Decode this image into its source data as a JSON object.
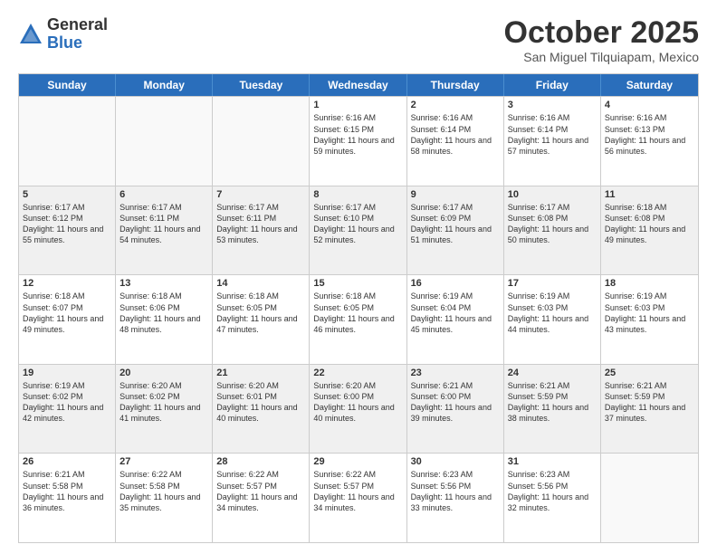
{
  "logo": {
    "general": "General",
    "blue": "Blue"
  },
  "title": "October 2025",
  "subtitle": "San Miguel Tilquiapam, Mexico",
  "days": [
    "Sunday",
    "Monday",
    "Tuesday",
    "Wednesday",
    "Thursday",
    "Friday",
    "Saturday"
  ],
  "rows": [
    [
      {
        "num": "",
        "info": "",
        "empty": true
      },
      {
        "num": "",
        "info": "",
        "empty": true
      },
      {
        "num": "",
        "info": "",
        "empty": true
      },
      {
        "num": "1",
        "info": "Sunrise: 6:16 AM\nSunset: 6:15 PM\nDaylight: 11 hours and 59 minutes."
      },
      {
        "num": "2",
        "info": "Sunrise: 6:16 AM\nSunset: 6:14 PM\nDaylight: 11 hours and 58 minutes."
      },
      {
        "num": "3",
        "info": "Sunrise: 6:16 AM\nSunset: 6:14 PM\nDaylight: 11 hours and 57 minutes."
      },
      {
        "num": "4",
        "info": "Sunrise: 6:16 AM\nSunset: 6:13 PM\nDaylight: 11 hours and 56 minutes."
      }
    ],
    [
      {
        "num": "5",
        "info": "Sunrise: 6:17 AM\nSunset: 6:12 PM\nDaylight: 11 hours and 55 minutes."
      },
      {
        "num": "6",
        "info": "Sunrise: 6:17 AM\nSunset: 6:11 PM\nDaylight: 11 hours and 54 minutes."
      },
      {
        "num": "7",
        "info": "Sunrise: 6:17 AM\nSunset: 6:11 PM\nDaylight: 11 hours and 53 minutes."
      },
      {
        "num": "8",
        "info": "Sunrise: 6:17 AM\nSunset: 6:10 PM\nDaylight: 11 hours and 52 minutes."
      },
      {
        "num": "9",
        "info": "Sunrise: 6:17 AM\nSunset: 6:09 PM\nDaylight: 11 hours and 51 minutes."
      },
      {
        "num": "10",
        "info": "Sunrise: 6:17 AM\nSunset: 6:08 PM\nDaylight: 11 hours and 50 minutes."
      },
      {
        "num": "11",
        "info": "Sunrise: 6:18 AM\nSunset: 6:08 PM\nDaylight: 11 hours and 49 minutes."
      }
    ],
    [
      {
        "num": "12",
        "info": "Sunrise: 6:18 AM\nSunset: 6:07 PM\nDaylight: 11 hours and 49 minutes."
      },
      {
        "num": "13",
        "info": "Sunrise: 6:18 AM\nSunset: 6:06 PM\nDaylight: 11 hours and 48 minutes."
      },
      {
        "num": "14",
        "info": "Sunrise: 6:18 AM\nSunset: 6:05 PM\nDaylight: 11 hours and 47 minutes."
      },
      {
        "num": "15",
        "info": "Sunrise: 6:18 AM\nSunset: 6:05 PM\nDaylight: 11 hours and 46 minutes."
      },
      {
        "num": "16",
        "info": "Sunrise: 6:19 AM\nSunset: 6:04 PM\nDaylight: 11 hours and 45 minutes."
      },
      {
        "num": "17",
        "info": "Sunrise: 6:19 AM\nSunset: 6:03 PM\nDaylight: 11 hours and 44 minutes."
      },
      {
        "num": "18",
        "info": "Sunrise: 6:19 AM\nSunset: 6:03 PM\nDaylight: 11 hours and 43 minutes."
      }
    ],
    [
      {
        "num": "19",
        "info": "Sunrise: 6:19 AM\nSunset: 6:02 PM\nDaylight: 11 hours and 42 minutes."
      },
      {
        "num": "20",
        "info": "Sunrise: 6:20 AM\nSunset: 6:02 PM\nDaylight: 11 hours and 41 minutes."
      },
      {
        "num": "21",
        "info": "Sunrise: 6:20 AM\nSunset: 6:01 PM\nDaylight: 11 hours and 40 minutes."
      },
      {
        "num": "22",
        "info": "Sunrise: 6:20 AM\nSunset: 6:00 PM\nDaylight: 11 hours and 40 minutes."
      },
      {
        "num": "23",
        "info": "Sunrise: 6:21 AM\nSunset: 6:00 PM\nDaylight: 11 hours and 39 minutes."
      },
      {
        "num": "24",
        "info": "Sunrise: 6:21 AM\nSunset: 5:59 PM\nDaylight: 11 hours and 38 minutes."
      },
      {
        "num": "25",
        "info": "Sunrise: 6:21 AM\nSunset: 5:59 PM\nDaylight: 11 hours and 37 minutes."
      }
    ],
    [
      {
        "num": "26",
        "info": "Sunrise: 6:21 AM\nSunset: 5:58 PM\nDaylight: 11 hours and 36 minutes."
      },
      {
        "num": "27",
        "info": "Sunrise: 6:22 AM\nSunset: 5:58 PM\nDaylight: 11 hours and 35 minutes."
      },
      {
        "num": "28",
        "info": "Sunrise: 6:22 AM\nSunset: 5:57 PM\nDaylight: 11 hours and 34 minutes."
      },
      {
        "num": "29",
        "info": "Sunrise: 6:22 AM\nSunset: 5:57 PM\nDaylight: 11 hours and 34 minutes."
      },
      {
        "num": "30",
        "info": "Sunrise: 6:23 AM\nSunset: 5:56 PM\nDaylight: 11 hours and 33 minutes."
      },
      {
        "num": "31",
        "info": "Sunrise: 6:23 AM\nSunset: 5:56 PM\nDaylight: 11 hours and 32 minutes."
      },
      {
        "num": "",
        "info": "",
        "empty": true
      }
    ]
  ]
}
